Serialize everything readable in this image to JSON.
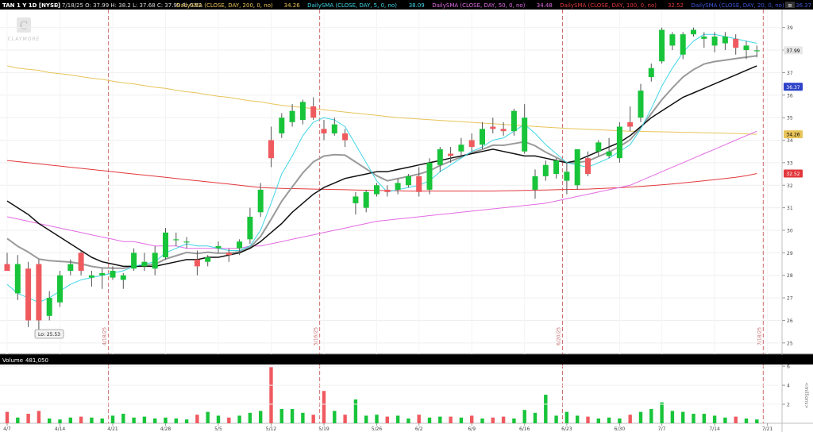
{
  "header": {
    "symbol": "TAN 1 Y 1D [NYSE]",
    "stats": "D: 7/18/25   O: 37.99   H: 38.2   L: 37.68   C: 37.99   R: 0.52",
    "studies": [
      {
        "label": "DailySMA (CLOSE, DAY, 200, 0, no)",
        "value": "34.26",
        "color": "#e8c45a"
      },
      {
        "label": "DailySMA (CLOSE, DAY, 5, 0, no)",
        "value": "38.09",
        "color": "#3fd6e6"
      },
      {
        "label": "DailySMA (CLOSE, DAY, 50, 0, no)",
        "value": "34.48",
        "color": "#e36ce3"
      },
      {
        "label": "DailySMA (CLOSE, DAY, 100, 0, no)",
        "value": "32.52",
        "color": "#e2383c"
      },
      {
        "label": "DailySMA (CLOSE, DAY, 20, 0, no)",
        "value": "36.37",
        "color": "#3d55d8"
      },
      {
        "label": "DailySMA (CLOSE, ...",
        "value": "",
        "color": "#cccccc"
      }
    ]
  },
  "watermark": "CLAYMORE",
  "volume_label": "Volume",
  "volume_value": "481,050",
  "volume_unit": "<millions>",
  "lo_label": "Lo: 25.53",
  "chart_data": {
    "type": "candlestick",
    "price_axis": {
      "min": 24.5,
      "max": 39.8,
      "ticks": [
        25,
        26,
        27,
        28,
        29,
        30,
        31,
        32,
        33,
        34,
        35,
        36,
        37,
        38,
        39
      ]
    },
    "volume_axis": {
      "max": 6,
      "ticks": [
        2,
        4,
        6
      ]
    },
    "x_ticks": [
      {
        "label": "4/7",
        "i": 0
      },
      {
        "label": "4/14",
        "i": 5
      },
      {
        "label": "4/21",
        "i": 10
      },
      {
        "label": "4/28",
        "i": 15
      },
      {
        "label": "5/5",
        "i": 20
      },
      {
        "label": "5/12",
        "i": 25
      },
      {
        "label": "5/19",
        "i": 30
      },
      {
        "label": "5/26",
        "i": 35
      },
      {
        "label": "6/2",
        "i": 39
      },
      {
        "label": "6/9",
        "i": 44
      },
      {
        "label": "6/16",
        "i": 49
      },
      {
        "label": "6/23",
        "i": 53
      },
      {
        "label": "6/30",
        "i": 58
      },
      {
        "label": "7/7",
        "i": 62
      },
      {
        "label": "7/14",
        "i": 67
      },
      {
        "label": "7/21",
        "i": 72
      }
    ],
    "date_markers": [
      {
        "label": "4/18/25",
        "i": 9.6
      },
      {
        "label": "5/16/25",
        "i": 29.6
      },
      {
        "label": "6/20/25",
        "i": 52.6
      },
      {
        "label": "7/18/25",
        "i": 71.6
      }
    ],
    "lo_index": 3,
    "candles": [
      [
        28.5,
        29.0,
        28.2,
        28.2
      ],
      [
        27.2,
        28.9,
        26.9,
        28.5
      ],
      [
        28.3,
        28.6,
        25.7,
        26.0
      ],
      [
        28.5,
        28.7,
        25.5,
        26.0
      ],
      [
        26.2,
        27.3,
        26.0,
        27.0
      ],
      [
        26.8,
        28.2,
        26.6,
        28.0
      ],
      [
        28.2,
        28.7,
        28.0,
        28.5
      ],
      [
        29.0,
        29.1,
        28.0,
        28.2
      ],
      [
        27.9,
        28.2,
        27.5,
        28.0
      ],
      [
        28.0,
        28.3,
        27.4,
        28.1
      ],
      [
        27.9,
        28.4,
        27.8,
        28.2
      ],
      [
        27.8,
        28.1,
        27.4,
        28.0
      ],
      [
        28.3,
        29.2,
        28.2,
        29.0
      ],
      [
        28.4,
        29.0,
        28.2,
        28.6
      ],
      [
        28.3,
        29.3,
        28.0,
        29.0
      ],
      [
        28.8,
        30.1,
        28.7,
        29.9
      ],
      [
        29.6,
        29.9,
        29.3,
        29.6
      ],
      [
        29.5,
        29.7,
        29.2,
        29.5
      ],
      [
        28.7,
        29.1,
        28.0,
        28.4
      ],
      [
        28.6,
        28.9,
        28.4,
        28.8
      ],
      [
        29.2,
        29.5,
        29.0,
        29.3
      ],
      [
        29.0,
        29.2,
        28.6,
        28.9
      ],
      [
        29.2,
        29.6,
        28.9,
        29.5
      ],
      [
        29.6,
        31.0,
        29.4,
        30.6
      ],
      [
        30.8,
        32.1,
        30.6,
        31.8
      ],
      [
        34.0,
        34.6,
        32.8,
        33.2
      ],
      [
        34.3,
        35.2,
        34.1,
        35.0
      ],
      [
        34.8,
        35.6,
        34.6,
        35.3
      ],
      [
        34.9,
        35.8,
        34.7,
        35.7
      ],
      [
        35.5,
        35.9,
        34.9,
        35.0
      ],
      [
        34.5,
        34.9,
        34.0,
        34.3
      ],
      [
        34.3,
        35.0,
        34.2,
        34.7
      ],
      [
        34.3,
        34.5,
        33.7,
        34.0
      ],
      [
        31.2,
        31.7,
        30.7,
        31.5
      ],
      [
        31.0,
        31.8,
        30.8,
        31.7
      ],
      [
        31.6,
        32.1,
        31.5,
        32.0
      ],
      [
        31.8,
        32.0,
        31.5,
        31.7
      ],
      [
        31.8,
        32.3,
        31.6,
        32.1
      ],
      [
        32.0,
        32.5,
        31.9,
        32.4
      ],
      [
        32.4,
        32.8,
        31.5,
        31.7
      ],
      [
        31.8,
        33.2,
        31.6,
        33.0
      ],
      [
        32.9,
        33.7,
        32.6,
        33.6
      ],
      [
        33.4,
        33.7,
        33.0,
        33.3
      ],
      [
        33.5,
        34.1,
        33.3,
        33.8
      ],
      [
        34.0,
        34.3,
        33.5,
        33.7
      ],
      [
        33.8,
        34.8,
        33.6,
        34.5
      ],
      [
        34.6,
        35.0,
        34.3,
        34.5
      ],
      [
        34.5,
        34.8,
        34.2,
        34.4
      ],
      [
        34.4,
        35.4,
        34.2,
        35.3
      ],
      [
        33.5,
        35.6,
        33.4,
        35.0
      ],
      [
        31.8,
        32.7,
        31.4,
        32.4
      ],
      [
        32.4,
        33.1,
        32.2,
        32.9
      ],
      [
        32.5,
        33.2,
        32.3,
        33.1
      ],
      [
        32.2,
        33.0,
        31.6,
        32.6
      ],
      [
        32.0,
        33.6,
        31.8,
        33.6
      ],
      [
        33.2,
        33.5,
        32.4,
        32.5
      ],
      [
        33.5,
        34.0,
        33.3,
        33.9
      ],
      [
        33.3,
        34.1,
        33.2,
        33.5
      ],
      [
        33.2,
        34.8,
        33.0,
        34.6
      ],
      [
        34.8,
        35.5,
        34.4,
        34.6
      ],
      [
        35.0,
        36.5,
        34.8,
        36.2
      ],
      [
        36.8,
        37.4,
        36.6,
        37.2
      ],
      [
        37.5,
        39.0,
        37.4,
        38.9
      ],
      [
        38.2,
        38.8,
        38.0,
        38.7
      ],
      [
        37.8,
        38.8,
        37.6,
        38.7
      ],
      [
        38.7,
        39.0,
        38.6,
        38.9
      ],
      [
        38.5,
        38.8,
        38.1,
        38.6
      ],
      [
        38.2,
        38.8,
        37.9,
        38.6
      ],
      [
        38.3,
        38.8,
        38.0,
        38.6
      ],
      [
        38.5,
        38.7,
        37.8,
        38.1
      ],
      [
        38.0,
        38.4,
        37.6,
        38.2
      ],
      [
        37.99,
        38.2,
        37.68,
        37.99
      ]
    ],
    "volumes": [
      1.2,
      0.6,
      1.0,
      1.3,
      0.5,
      0.4,
      0.6,
      0.7,
      0.6,
      0.5,
      0.8,
      1.0,
      0.6,
      0.7,
      0.5,
      0.6,
      0.5,
      0.4,
      0.9,
      1.2,
      0.8,
      0.6,
      0.8,
      1.1,
      1.3,
      5.9,
      1.5,
      1.5,
      1.1,
      0.9,
      3.4,
      1.3,
      0.9,
      2.5,
      0.8,
      0.9,
      0.7,
      0.8,
      0.5,
      0.9,
      0.6,
      0.7,
      0.7,
      0.6,
      0.8,
      0.5,
      0.6,
      0.7,
      0.5,
      1.4,
      1.1,
      3.0,
      0.8,
      1.2,
      0.8,
      0.7,
      0.5,
      0.6,
      0.5,
      0.9,
      1.2,
      1.5,
      2.2,
      1.3,
      1.2,
      1.0,
      1.0,
      0.8,
      0.6,
      0.7,
      0.5,
      0.4
    ],
    "sma_lines": {
      "sma5": [
        27.6,
        27.2,
        27.0,
        26.8,
        27.0,
        27.3,
        27.6,
        27.8,
        27.9,
        28.0,
        28.1,
        28.2,
        28.4,
        28.5,
        28.6,
        29.0,
        29.2,
        29.4,
        29.3,
        29.3,
        29.2,
        29.1,
        29.1,
        29.3,
        30.0,
        31.2,
        32.5,
        33.3,
        34.2,
        34.8,
        35.0,
        34.9,
        34.6,
        33.8,
        33.0,
        32.2,
        31.7,
        31.8,
        31.9,
        32.0,
        32.2,
        32.6,
        32.9,
        33.2,
        33.5,
        33.7,
        34.0,
        34.1,
        34.4,
        34.7,
        34.3,
        33.8,
        33.4,
        33.0,
        32.9,
        32.8,
        33.0,
        33.2,
        33.5,
        33.8,
        34.5,
        35.4,
        36.4,
        37.2,
        37.9,
        38.4,
        38.7,
        38.7,
        38.6,
        38.5,
        38.4,
        38.3
      ],
      "sma20": [
        31.3,
        31.0,
        30.7,
        30.3,
        30.0,
        29.7,
        29.4,
        29.1,
        28.8,
        28.6,
        28.5,
        28.4,
        28.4,
        28.4,
        28.4,
        28.5,
        28.6,
        28.7,
        28.7,
        28.8,
        28.8,
        28.9,
        29.0,
        29.2,
        29.5,
        29.9,
        30.3,
        30.8,
        31.2,
        31.6,
        31.9,
        32.1,
        32.3,
        32.4,
        32.5,
        32.6,
        32.6,
        32.7,
        32.8,
        32.9,
        33.0,
        33.1,
        33.2,
        33.3,
        33.4,
        33.5,
        33.6,
        33.5,
        33.4,
        33.3,
        33.3,
        33.2,
        33.1,
        33.0,
        33.1,
        33.3,
        33.5,
        33.7,
        33.9,
        34.2,
        34.6,
        35.0,
        35.3,
        35.6,
        35.9,
        36.1,
        36.3,
        36.5,
        36.7,
        36.9,
        37.1,
        37.3
      ],
      "sma50": [
        30.6,
        30.5,
        30.4,
        30.3,
        30.2,
        30.1,
        30.0,
        29.9,
        29.8,
        29.7,
        29.6,
        29.5,
        29.5,
        29.4,
        29.3,
        29.3,
        29.3,
        29.2,
        29.2,
        29.2,
        29.2,
        29.2,
        29.2,
        29.3,
        29.3,
        29.4,
        29.5,
        29.6,
        29.7,
        29.8,
        29.9,
        30.0,
        30.1,
        30.2,
        30.3,
        30.4,
        30.45,
        30.5,
        30.55,
        30.6,
        30.65,
        30.7,
        30.75,
        30.8,
        30.85,
        30.9,
        30.95,
        31.0,
        31.05,
        31.1,
        31.15,
        31.2,
        31.3,
        31.4,
        31.5,
        31.6,
        31.7,
        31.8,
        31.9,
        32.0,
        32.2,
        32.4,
        32.6,
        32.8,
        33.0,
        33.2,
        33.4,
        33.6,
        33.8,
        34.0,
        34.2,
        34.4
      ],
      "sma100": [
        33.1,
        33.05,
        33.0,
        32.95,
        32.9,
        32.85,
        32.8,
        32.75,
        32.7,
        32.65,
        32.6,
        32.55,
        32.5,
        32.45,
        32.4,
        32.35,
        32.3,
        32.25,
        32.2,
        32.15,
        32.1,
        32.05,
        32.0,
        31.95,
        31.9,
        31.88,
        31.86,
        31.85,
        31.84,
        31.83,
        31.82,
        31.81,
        31.8,
        31.79,
        31.78,
        31.77,
        31.76,
        31.75,
        31.74,
        31.74,
        31.74,
        31.74,
        31.74,
        31.74,
        31.74,
        31.74,
        31.74,
        31.75,
        31.76,
        31.77,
        31.78,
        31.79,
        31.8,
        31.81,
        31.82,
        31.83,
        31.85,
        31.87,
        31.89,
        31.92,
        31.95,
        31.98,
        32.02,
        32.06,
        32.1,
        32.15,
        32.2,
        32.25,
        32.3,
        32.35,
        32.42,
        32.52
      ],
      "sma200": [
        37.3,
        37.2,
        37.15,
        37.1,
        37.0,
        36.95,
        36.9,
        36.82,
        36.75,
        36.7,
        36.62,
        36.55,
        36.5,
        36.42,
        36.35,
        36.3,
        36.22,
        36.15,
        36.1,
        36.02,
        35.95,
        35.9,
        35.82,
        35.75,
        35.7,
        35.62,
        35.55,
        35.5,
        35.45,
        35.4,
        35.35,
        35.3,
        35.25,
        35.2,
        35.15,
        35.1,
        35.05,
        35.0,
        34.97,
        34.94,
        34.91,
        34.88,
        34.85,
        34.82,
        34.79,
        34.76,
        34.73,
        34.7,
        34.67,
        34.64,
        34.61,
        34.58,
        34.55,
        34.52,
        34.5,
        34.48,
        34.46,
        34.44,
        34.42,
        34.4,
        34.39,
        34.38,
        34.37,
        34.36,
        34.35,
        34.34,
        34.33,
        34.32,
        34.31,
        34.3,
        34.28,
        34.26
      ]
    },
    "last_labels": [
      {
        "value": "37.99",
        "bg": "#e8e8e8",
        "fg": "#000000"
      },
      {
        "value": "36.37",
        "bg": "#2e43c9",
        "fg": "#ffffff"
      },
      {
        "value": "34.26",
        "bg": "#e8c45a",
        "fg": "#000000"
      },
      {
        "value": "32.52",
        "bg": "#e2383c",
        "fg": "#ffffff"
      }
    ],
    "colors": {
      "up": "#18c43a",
      "down": "#ef5a5f",
      "grid": "#1f1f1f",
      "marker": "#c85a5a",
      "sma5": "#3fd6e6",
      "sma20": "#111111",
      "sma20_alt": "#9a9a9a",
      "sma50": "#e36ce3",
      "sma100": "#e2383c",
      "sma200": "#e8c45a"
    }
  }
}
